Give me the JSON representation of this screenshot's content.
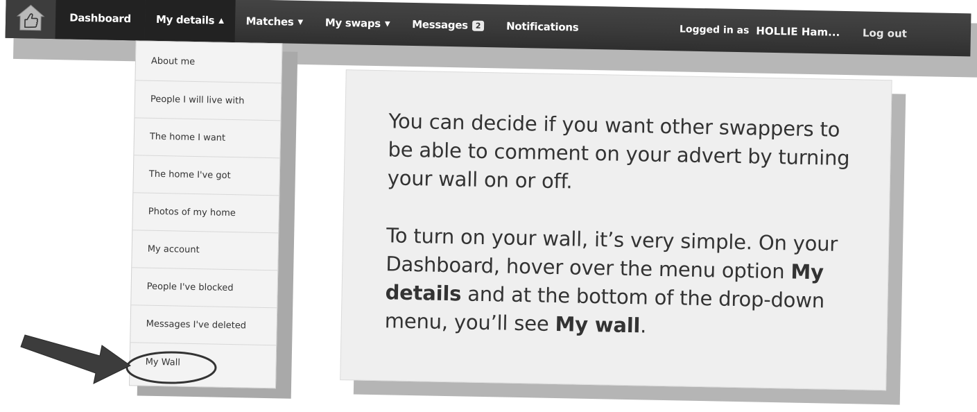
{
  "nav": {
    "home_icon": "thumbs-up-house-icon",
    "items": [
      {
        "label": "Dashboard"
      },
      {
        "label": "My details",
        "caret": "▲"
      },
      {
        "label": "Matches",
        "caret": "▼"
      },
      {
        "label": "My swaps",
        "caret": "▼"
      },
      {
        "label": "Messages",
        "badge": "2"
      },
      {
        "label": "Notifications"
      }
    ],
    "logged_in_prefix": "Logged in as",
    "user": "HOLLIE Ham...",
    "logout": "Log out"
  },
  "dropdown": {
    "items": [
      {
        "label": "About me"
      },
      {
        "label": "People I will live with"
      },
      {
        "label": "The home I want"
      },
      {
        "label": "The home I've got"
      },
      {
        "label": "Photos of my home"
      },
      {
        "label": "My account"
      },
      {
        "label": "People I've blocked"
      },
      {
        "label": "Messages I've deleted"
      },
      {
        "label": "My Wall"
      }
    ]
  },
  "callout": {
    "para1": "You can decide if you want other swappers to be able to comment on your advert by turning your wall on or off.",
    "para2_a": "To turn on your wall, it’s very simple. On your Dashboard, hover over the menu option ",
    "para2_b": "My details",
    "para2_c": " and at the bottom of the drop-down menu, you’ll see ",
    "para2_d": "My wall",
    "para2_e": "."
  },
  "colors": {
    "navbar": "#3a3a3a",
    "nav_active": "#222222",
    "dropdown_bg": "#f3f3f3",
    "callout_bg": "#efefef",
    "shadow": "#b5b5b5"
  }
}
